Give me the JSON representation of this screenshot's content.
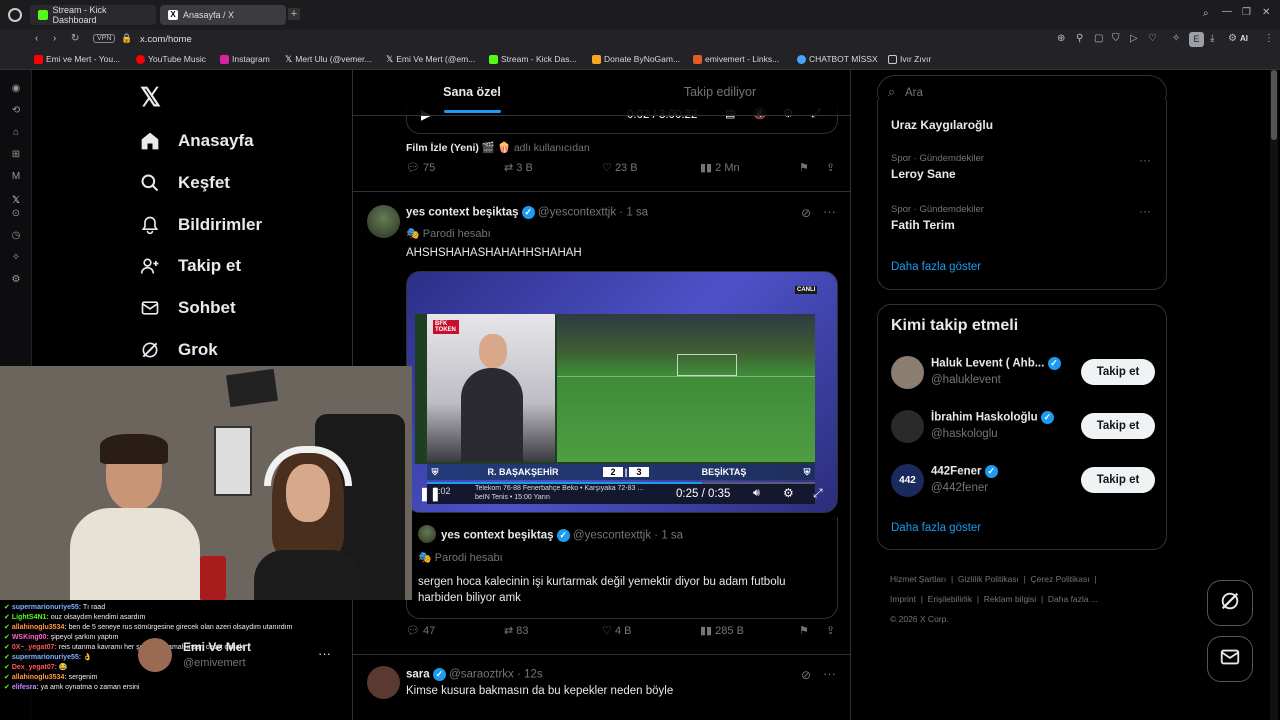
{
  "browser": {
    "tabs": [
      {
        "label": "Stream - Kick Dashboard",
        "icon": "kick-icon",
        "active": false
      },
      {
        "label": "Anasayfa / X",
        "icon": "x-icon",
        "active": true
      }
    ],
    "vpn_label": "VPN",
    "url": "x.com/home",
    "profile_letter": "E",
    "ai_label": "AI",
    "bookmarks": [
      {
        "label": "Emi ve Mert - You...",
        "icon": "youtube-icon",
        "color": "#ff0000"
      },
      {
        "label": "YouTube Music",
        "icon": "youtube-music-icon",
        "color": "#ff0000"
      },
      {
        "label": "Instagram",
        "icon": "instagram-icon",
        "color": "#d6249f"
      },
      {
        "label": "Mert Ulu (@vemer...",
        "icon": "x-icon",
        "color": "#ffffff"
      },
      {
        "label": "Emi Ve Mert (@em...",
        "icon": "x-icon",
        "color": "#ffffff"
      },
      {
        "label": "Stream - Kick Das...",
        "icon": "kick-icon",
        "color": "#53fc18"
      },
      {
        "label": "Donate ByNoGam...",
        "icon": "donate-icon",
        "color": "#f5a623"
      },
      {
        "label": "emivemert - Links...",
        "icon": "linktree-icon",
        "color": "#e05a2b"
      },
      {
        "label": "CHATBOT MİSSX",
        "icon": "chatbot-icon",
        "color": "#4aa3ff"
      },
      {
        "label": "Ivır Zıvır",
        "icon": "folder-icon",
        "color": "#cccccc"
      }
    ]
  },
  "nav": {
    "items": [
      {
        "label": "Anasayfa",
        "icon": "home-icon"
      },
      {
        "label": "Keşfet",
        "icon": "search-icon"
      },
      {
        "label": "Bildirimler",
        "icon": "bell-icon"
      },
      {
        "label": "Takip et",
        "icon": "follow-icon"
      },
      {
        "label": "Sohbet",
        "icon": "mail-icon"
      },
      {
        "label": "Grok",
        "icon": "grok-icon"
      }
    ]
  },
  "feed": {
    "tabs": [
      {
        "label": "Sana özel",
        "active": true
      },
      {
        "label": "Takip ediliyor",
        "active": false
      }
    ],
    "prev_post": {
      "video_time": "0:02 / 3:00:22",
      "caption": "Film İzle (Yeni) 🎬 🍿",
      "caption_suffix": "adlı kullanıcıdan",
      "replies": "75",
      "reposts": "3 B",
      "likes": "23 B",
      "views": "2 Mn"
    },
    "post": {
      "name": "yes context beşiktaş",
      "handle": "@yescontexttjk",
      "time": "1 sa",
      "badge": "Parodi hesabı",
      "text": "AHSHSHAHASHAHAHHSHAHAH",
      "video": {
        "live_label": "CANLI",
        "team_home": "R. BAŞAKŞEHİR",
        "team_away": "BEŞİKTAŞ",
        "score_home": "2",
        "score_away": "3",
        "match_clock": "3:02",
        "ticker": "Telekom 76-88 Fenerbahçe Beko • Karşıyaka 72-83 ...",
        "ticker2": "beIN Tenis • 15:00  Yarın",
        "sponsor": "BFK TOKEN",
        "time": "0:25 / 0:35",
        "progress": 0.71
      },
      "quote": {
        "name": "yes context beşiktaş",
        "handle": "@yescontexttjk",
        "time": "1 sa",
        "badge": "Parodi hesabı",
        "text": "sergen hoca kalecinin işi kurtarmak değil yemektir diyor bu adam futbolu harbiden biliyor amk"
      },
      "replies": "47",
      "reposts": "83",
      "likes": "4 B",
      "views": "285 B"
    },
    "next_post": {
      "name": "sara",
      "handle": "@saraoztrkx",
      "time": "12s",
      "text": "Kimse kusura bakmasın da bu kepekler neden böyle"
    }
  },
  "right": {
    "search_placeholder": "Ara",
    "trends": [
      {
        "category": "",
        "title": "Uraz Kaygılaroğlu"
      },
      {
        "category": "Spor · Gündemdekiler",
        "title": "Leroy Sane"
      },
      {
        "category": "Spor · Gündemdekiler",
        "title": "Fatih Terim"
      }
    ],
    "show_more": "Daha fazla göster",
    "who_to_follow_title": "Kimi takip etmeli",
    "suggestions": [
      {
        "name": "Haluk Levent ( Ahb...",
        "handle": "@haluklevent",
        "button": "Takip et",
        "avatar_color": "#8b7d70"
      },
      {
        "name": "İbrahim Haskoloğlu",
        "handle": "@haskologlu",
        "button": "Takip et",
        "avatar_color": "#2a2a2a"
      },
      {
        "name": "442Fener",
        "handle": "@442fener",
        "button": "Takip et",
        "avatar_color": "#1b2a5c",
        "avatar_text": "442"
      }
    ],
    "show_more2": "Daha fazla göster",
    "footer": [
      "Hizmet Şartları",
      "Gizlilik Politikası",
      "Çerez Politikası",
      "Imprint",
      "Erişilebilirlik",
      "Reklam bilgisi",
      "Daha fazla ...",
      "© 2026 X Corp."
    ]
  },
  "stream": {
    "channel": "Emi Ve Mert",
    "channel_handle": "@emivemert",
    "chat": [
      {
        "user": "supermarionuriye55:",
        "msg": "Tı raad",
        "color": "#7fb1ff"
      },
      {
        "user": "LightS4N1:",
        "msg": "ouz olsaydım kendimi asardım",
        "color": "#53fc18"
      },
      {
        "user": "allahinoglu3534:",
        "msg": "ben de 5 seneye rus sömürgesine girecek olan azeri olsaydım utanırdım",
        "color": "#ff9c3a"
      },
      {
        "user": "WSKing00:",
        "msg": "şipeyol şarkını yaptım",
        "color": "#ff66cc"
      },
      {
        "user": "0X~_yegat07:",
        "msg": "reis utanma kavramı her şeyde olmamalı insan ceset olmalı",
        "color": "#ff5555"
      },
      {
        "user": "supermarionuriye55:",
        "msg": "👌",
        "color": "#7fb1ff"
      },
      {
        "user": "Dex_yegat07:",
        "msg": "😂",
        "color": "#ff5555"
      },
      {
        "user": "allahinoglu3534:",
        "msg": "sergenim",
        "color": "#ff9c3a"
      },
      {
        "user": "elifesra:",
        "msg": "ya amk oynatma o zaman ersini",
        "color": "#c58bff"
      }
    ]
  }
}
